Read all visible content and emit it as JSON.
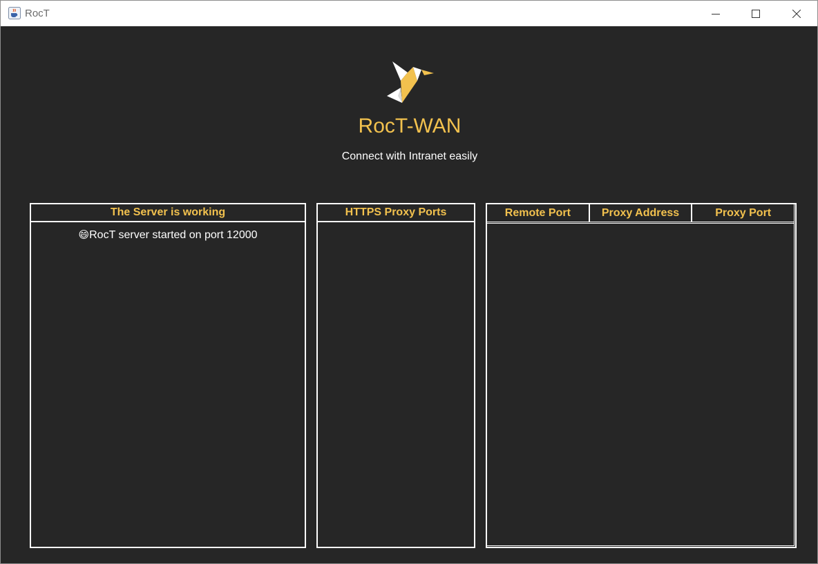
{
  "window": {
    "title": "RocT"
  },
  "header": {
    "app_title": "RocT-WAN",
    "subtitle": "Connect with Intranet easily"
  },
  "server_panel": {
    "header": "The Server is working",
    "log_icon": "😄",
    "log": [
      "RocT server started on port 12000"
    ]
  },
  "https_panel": {
    "header": "HTTPS Proxy Ports",
    "items": []
  },
  "proxy_table": {
    "columns": [
      "Remote Port",
      "Proxy Address",
      "Proxy Port"
    ],
    "rows": []
  },
  "colors": {
    "background": "#262626",
    "accent": "#f2c14e",
    "text": "#ffffff",
    "border": "#ffffff"
  },
  "icons": {
    "app": "java-cup-icon",
    "logo": "origami-bird-icon",
    "minimize": "minimize-icon",
    "maximize": "maximize-icon",
    "close": "close-icon"
  }
}
